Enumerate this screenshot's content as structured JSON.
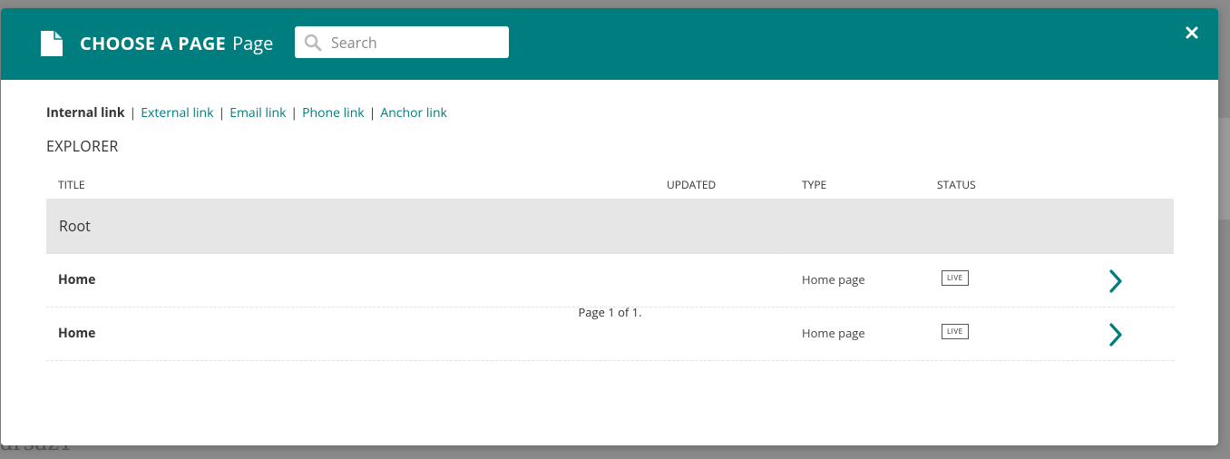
{
  "colors": {
    "header_bg": "#007d7e",
    "accent": "#007d7e",
    "root_row_bg": "#e6e6e6"
  },
  "modal": {
    "title_strong": "CHOOSE A PAGE",
    "title_sub": "Page",
    "search": {
      "placeholder": "Search",
      "value": ""
    },
    "close_icon": "close-icon",
    "doc_icon": "document-icon"
  },
  "link_types": {
    "active": "Internal link",
    "links": [
      "External link",
      "Email link",
      "Phone link",
      "Anchor link"
    ],
    "separator": "|"
  },
  "explorer": {
    "title": "EXPLORER",
    "columns": {
      "title": "TITLE",
      "updated": "UPDATED",
      "type": "TYPE",
      "status": "STATUS"
    },
    "root": "Root",
    "rows": [
      {
        "title": "Home",
        "updated": "",
        "type": "Home page",
        "status": "LIVE"
      },
      {
        "title": "Home",
        "updated": "",
        "type": "Home page",
        "status": "LIVE"
      }
    ],
    "pagination": "Page 1 of 1."
  }
}
